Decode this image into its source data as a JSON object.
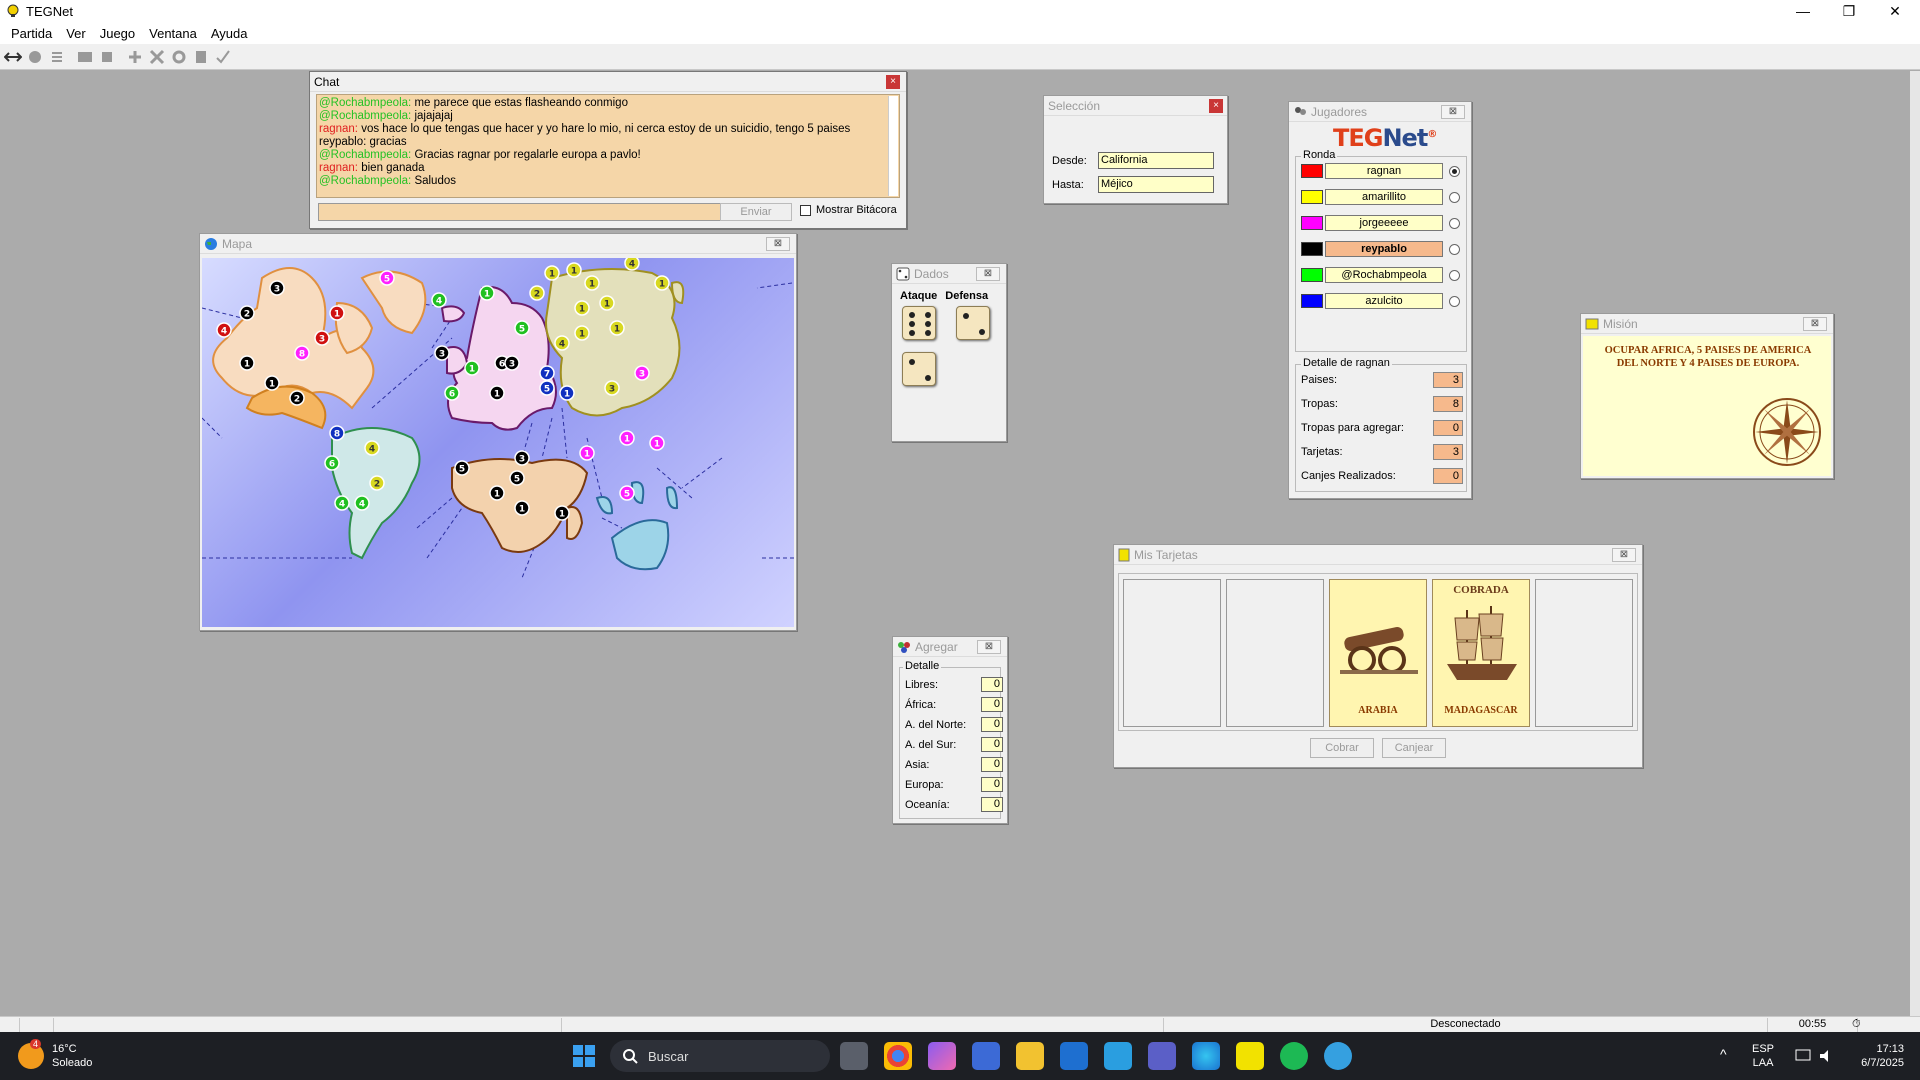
{
  "app": {
    "title": "TEGNet"
  },
  "menu": [
    "Partida",
    "Ver",
    "Juego",
    "Ventana",
    "Ayuda"
  ],
  "chat": {
    "title": "Chat",
    "messages": [
      {
        "nick": "@Rochabmpeola:",
        "text": "me parece que estas flasheando conmigo",
        "color": "#25c225"
      },
      {
        "nick": "@Rochabmpeola:",
        "text": "jajajajaj",
        "color": "#25c225"
      },
      {
        "nick": "ragnan:",
        "text": "vos hace lo que tengas que hacer y yo hare lo mio, ni cerca estoy de un suicidio, tengo 5 paises",
        "color": "#e02020"
      },
      {
        "nick": "reypablo:",
        "text": "gracias",
        "color": "#000000"
      },
      {
        "nick": "@Rochabmpeola:",
        "text": "Gracias ragnar por regalarle europa a pavlo!",
        "color": "#25c225"
      },
      {
        "nick": "ragnan:",
        "text": "bien ganada",
        "color": "#e02020"
      },
      {
        "nick": "@Rochabmpeola:",
        "text": "Saludos",
        "color": "#25c225"
      }
    ],
    "send_label": "Enviar",
    "log_toggle_label": "Mostrar Bitácora"
  },
  "mapa": {
    "title": "Mapa"
  },
  "seleccion": {
    "title": "Selección",
    "desde_label": "Desde:",
    "desde_value": "California",
    "hasta_label": "Hasta:",
    "hasta_value": "Méjico"
  },
  "dados": {
    "title": "Dados",
    "ataque_label": "Ataque",
    "defensa_label": "Defensa",
    "attack_dice": [
      6,
      2
    ],
    "defense_dice": [
      2
    ]
  },
  "agregar": {
    "title": "Agregar",
    "group_label": "Detalle",
    "rows": [
      {
        "label": "Libres:",
        "value": "0"
      },
      {
        "label": "África:",
        "value": "0"
      },
      {
        "label": "A. del Norte:",
        "value": "0"
      },
      {
        "label": "A. del Sur:",
        "value": "0"
      },
      {
        "label": "Asia:",
        "value": "0"
      },
      {
        "label": "Europa:",
        "value": "0"
      },
      {
        "label": "Oceanía:",
        "value": "0"
      }
    ]
  },
  "jugadores": {
    "title": "Jugadores",
    "logo": {
      "teg": "TEG",
      "net": "Net",
      "mark": "®"
    },
    "ronda_label": "Ronda",
    "players": [
      {
        "name": "ragnan",
        "color": "#ff0000",
        "turn": true,
        "active": false
      },
      {
        "name": "amarillito",
        "color": "#ffff00",
        "turn": false,
        "active": false
      },
      {
        "name": "jorgeeeee",
        "color": "#ff00ff",
        "turn": false,
        "active": false
      },
      {
        "name": "reypablo",
        "color": "#000000",
        "turn": false,
        "active": true
      },
      {
        "name": "@Rochabmpeola",
        "color": "#00ff00",
        "turn": false,
        "active": false
      },
      {
        "name": "azulcito",
        "color": "#0000ff",
        "turn": false,
        "active": false
      }
    ],
    "detail_label": "Detalle de ragnan",
    "detail": [
      {
        "label": "Paises:",
        "value": "3"
      },
      {
        "label": "Tropas:",
        "value": "8"
      },
      {
        "label": "Tropas para agregar:",
        "value": "0"
      },
      {
        "label": "Tarjetas:",
        "value": "3"
      },
      {
        "label": "Canjes Realizados:",
        "value": "0"
      }
    ]
  },
  "mision": {
    "title": "Misión",
    "text": "OCUPAR AFRICA, 5 PAISES DE AMERICA DEL NORTE Y 4 PAISES DE EUROPA."
  },
  "tarjetas": {
    "title": "Mis Tarjetas",
    "cards": [
      {
        "filled": false,
        "top": "",
        "name": "",
        "art": ""
      },
      {
        "filled": false,
        "top": "",
        "name": "",
        "art": ""
      },
      {
        "filled": true,
        "top": "",
        "name": "ARABIA",
        "art": "cannon"
      },
      {
        "filled": true,
        "top": "COBRADA",
        "name": "MADAGASCAR",
        "art": "galleon"
      },
      {
        "filled": false,
        "top": "",
        "name": "",
        "art": ""
      }
    ],
    "cobrar_label": "Cobrar",
    "canjear_label": "Canjear"
  },
  "statusbar": {
    "connection": "Desconectado",
    "timer": "00:55"
  },
  "taskbar": {
    "weather_temp": "16°C",
    "weather_desc": "Soleado",
    "weather_badge": "4",
    "search_label": "Buscar",
    "lang_top": "ESP",
    "lang_bottom": "LAA",
    "time": "17:13",
    "date": "6/7/2025"
  },
  "map_armies": [
    {
      "region": "america-norte",
      "color": "#000000",
      "count": "3"
    },
    {
      "region": "america-norte",
      "color": "#000000",
      "count": "2"
    },
    {
      "region": "america-norte",
      "color": "#d01010",
      "count": "4"
    },
    {
      "region": "america-norte",
      "color": "#d01010",
      "count": "1"
    },
    {
      "region": "america-norte",
      "color": "#d01010",
      "count": "3"
    },
    {
      "region": "america-norte",
      "color": "#ff20ff",
      "count": "8"
    },
    {
      "region": "america-norte",
      "color": "#000000",
      "count": "1"
    },
    {
      "region": "america-norte",
      "color": "#000000",
      "count": "1"
    },
    {
      "region": "america-norte",
      "color": "#000000",
      "count": "2"
    },
    {
      "region": "america-norte",
      "color": "#ff20ff",
      "count": "5"
    },
    {
      "region": "america-sur",
      "color": "#1030c0",
      "count": "8"
    },
    {
      "region": "america-sur",
      "color": "#d8d820",
      "count": "4"
    },
    {
      "region": "america-sur",
      "color": "#20c020",
      "count": "6"
    },
    {
      "region": "america-sur",
      "color": "#d8d820",
      "count": "2"
    },
    {
      "region": "america-sur",
      "color": "#20c020",
      "count": "4"
    },
    {
      "region": "america-sur",
      "color": "#20c020",
      "count": "4"
    },
    {
      "region": "europa",
      "color": "#20c020",
      "count": "4"
    },
    {
      "region": "europa",
      "color": "#20c020",
      "count": "1"
    },
    {
      "region": "europa",
      "color": "#20c020",
      "count": "5"
    },
    {
      "region": "europa",
      "color": "#000000",
      "count": "3"
    },
    {
      "region": "europa",
      "color": "#000000",
      "count": "6"
    },
    {
      "region": "europa",
      "color": "#000000",
      "count": "3"
    },
    {
      "region": "europa",
      "color": "#20c020",
      "count": "1"
    },
    {
      "region": "europa",
      "color": "#20c020",
      "count": "6"
    },
    {
      "region": "europa",
      "color": "#000000",
      "count": "1"
    },
    {
      "region": "europa",
      "color": "#1030c0",
      "count": "7"
    },
    {
      "region": "europa",
      "color": "#1030c0",
      "count": "5"
    },
    {
      "region": "europa",
      "color": "#1030c0",
      "count": "1"
    },
    {
      "region": "asia",
      "color": "#d8d820",
      "count": "1"
    },
    {
      "region": "asia",
      "color": "#d8d820",
      "count": "1"
    },
    {
      "region": "asia",
      "color": "#d8d820",
      "count": "4"
    },
    {
      "region": "asia",
      "color": "#d8d820",
      "count": "2"
    },
    {
      "region": "asia",
      "color": "#d8d820",
      "count": "1"
    },
    {
      "region": "asia",
      "color": "#d8d820",
      "count": "1"
    },
    {
      "region": "asia",
      "color": "#d8d820",
      "count": "1"
    },
    {
      "region": "asia",
      "color": "#d8d820",
      "count": "1"
    },
    {
      "region": "asia",
      "color": "#d8d820",
      "count": "1"
    },
    {
      "region": "asia",
      "color": "#d8d820",
      "count": "1"
    },
    {
      "region": "asia",
      "color": "#d8d820",
      "count": "4"
    },
    {
      "region": "asia",
      "color": "#d8d820",
      "count": "3"
    },
    {
      "region": "asia",
      "color": "#ff20ff",
      "count": "3"
    },
    {
      "region": "africa",
      "color": "#000000",
      "count": "5"
    },
    {
      "region": "africa",
      "color": "#000000",
      "count": "3"
    },
    {
      "region": "africa",
      "color": "#000000",
      "count": "5"
    },
    {
      "region": "africa",
      "color": "#000000",
      "count": "1"
    },
    {
      "region": "africa",
      "color": "#000000",
      "count": "1"
    },
    {
      "region": "africa",
      "color": "#000000",
      "count": "1"
    },
    {
      "region": "oceania",
      "color": "#ff20ff",
      "count": "1"
    },
    {
      "region": "oceania",
      "color": "#ff20ff",
      "count": "1"
    },
    {
      "region": "oceania",
      "color": "#ff20ff",
      "count": "1"
    },
    {
      "region": "oceania",
      "color": "#ff20ff",
      "count": "5"
    }
  ]
}
